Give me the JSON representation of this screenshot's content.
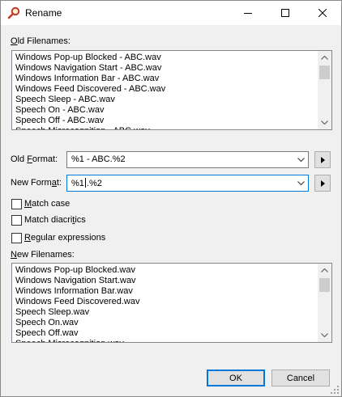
{
  "window": {
    "title": "Rename",
    "icon": "magnifier-icon"
  },
  "old_filenames": {
    "label_underline": "O",
    "label_rest": "ld Filenames:",
    "rows": [
      "Windows Pop-up Blocked - ABC.wav",
      "Windows Navigation Start - ABC.wav",
      "Windows Information Bar - ABC.wav",
      "Windows Feed Discovered - ABC.wav",
      "Speech Sleep - ABC.wav",
      "Speech On - ABC.wav",
      "Speech Off - ABC.wav",
      "Speech Misrecognition - ABC.wav"
    ]
  },
  "old_format": {
    "label_pre": "Old ",
    "label_underline": "F",
    "label_post": "ormat:",
    "value": "%1 - ABC.%2"
  },
  "new_format": {
    "label_pre": "New Form",
    "label_underline": "a",
    "label_post": "t:",
    "value_before_cursor": "%1",
    "value_after_cursor": ".%2"
  },
  "options": {
    "match_case": {
      "label_underline": "M",
      "label_rest": "atch case",
      "checked": false
    },
    "match_diacritics": {
      "label_pre": "Match diacri",
      "label_underline": "t",
      "label_post": "ics",
      "checked": false
    },
    "regular_expressions": {
      "label_underline": "R",
      "label_rest": "egular expressions",
      "checked": false
    }
  },
  "new_filenames": {
    "label_underline": "N",
    "label_rest": "ew Filenames:",
    "rows": [
      "Windows Pop-up Blocked.wav",
      "Windows Navigation Start.wav",
      "Windows Information Bar.wav",
      "Windows Feed Discovered.wav",
      "Speech Sleep.wav",
      "Speech On.wav",
      "Speech Off.wav",
      "Speech Misrecognition.wav"
    ]
  },
  "buttons": {
    "ok": "OK",
    "cancel": "Cancel"
  },
  "colors": {
    "focus_border": "#0078d7",
    "dialog_bg": "#f0f0f0"
  }
}
